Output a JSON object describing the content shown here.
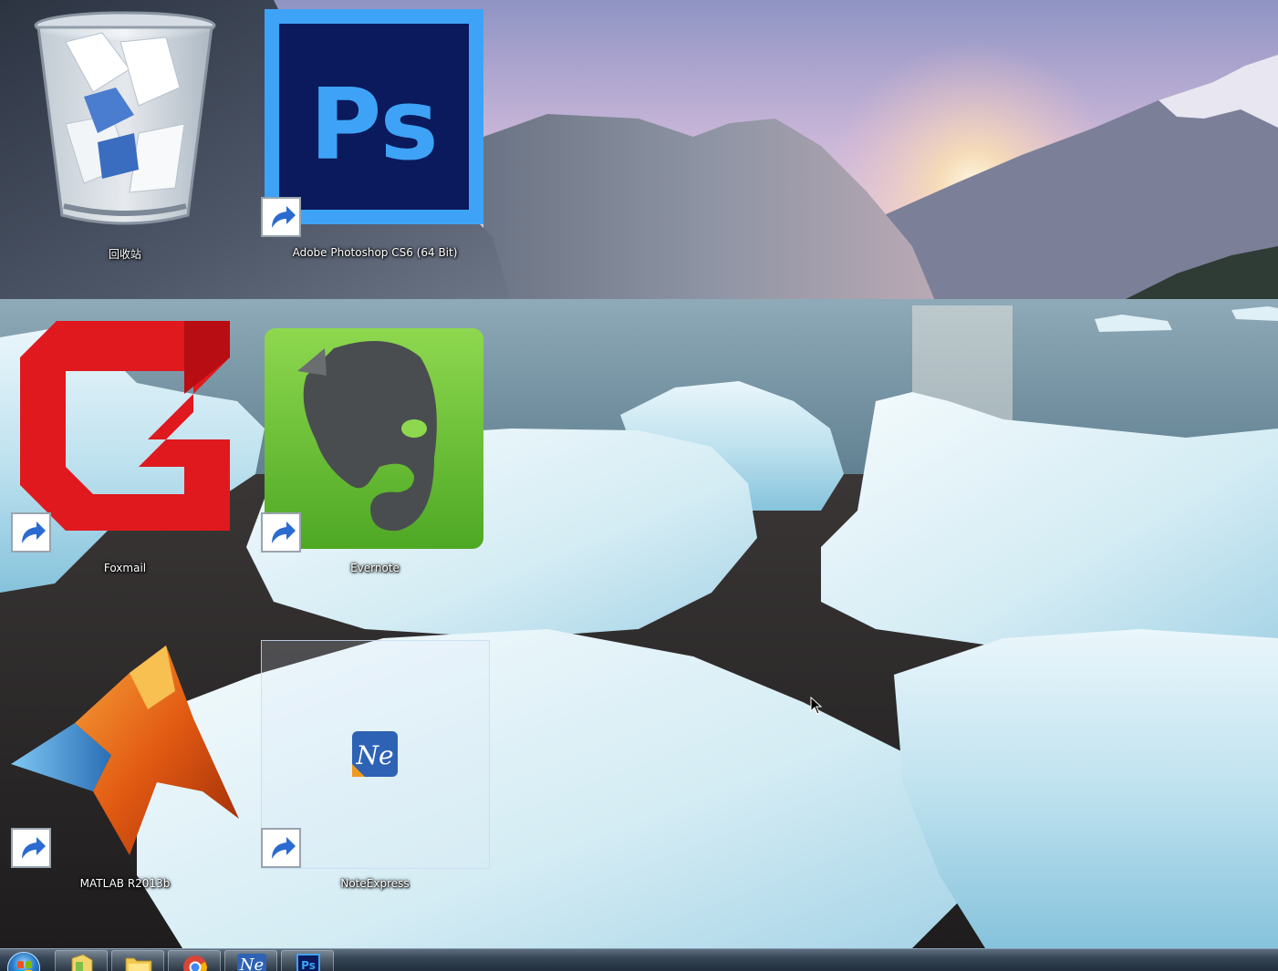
{
  "desktop": {
    "icons": [
      {
        "id": "recycle-bin",
        "label": "回收站",
        "shortcut": false
      },
      {
        "id": "photoshop",
        "label": "Adobe Photoshop CS6 (64 Bit)",
        "shortcut": true
      },
      {
        "id": "foxmail",
        "label": "Foxmail",
        "shortcut": true
      },
      {
        "id": "evernote",
        "label": "Evernote",
        "shortcut": true
      },
      {
        "id": "matlab",
        "label": "MATLAB R2013b",
        "shortcut": true
      },
      {
        "id": "noteexpress",
        "label": "NoteExpress",
        "shortcut": true,
        "selected": true
      }
    ],
    "photoshop_glyph": "Ps",
    "noteexpress_glyph": "Ne"
  },
  "taskbar": {
    "start_icon": "windows-start-orb-icon",
    "pinned": [
      {
        "name": "explorer-libraries",
        "icon": "libraries-icon"
      },
      {
        "name": "windows-explorer",
        "icon": "folder-icon"
      },
      {
        "name": "google-chrome",
        "icon": "chrome-icon"
      },
      {
        "name": "noteexpress",
        "icon": "noteexpress-icon",
        "glyph": "Ne"
      },
      {
        "name": "photoshop",
        "icon": "photoshop-icon",
        "glyph": "Ps"
      }
    ]
  },
  "colors": {
    "photoshop_bg": "#0b1a5c",
    "photoshop_accent": "#3ea3f6",
    "foxmail_red": "#e0191e",
    "evernote_green": "#6fc53a",
    "noteexpress_blue": "#2d62b5"
  }
}
